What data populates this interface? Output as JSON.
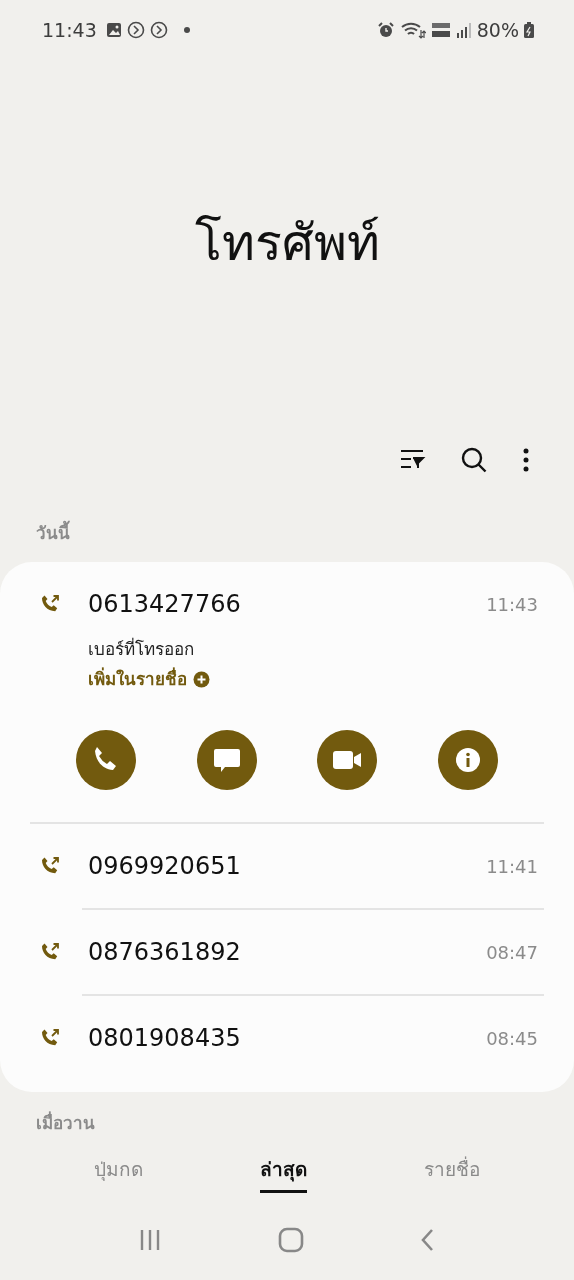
{
  "status_bar": {
    "time": "11:43",
    "battery": "80%"
  },
  "title": "โทรศัพท์",
  "sections": [
    {
      "header": "วันนี้",
      "calls": [
        {
          "number": "0613427766",
          "time": "11:43",
          "expanded": true,
          "detail": "เบอร์ที่โทรออก",
          "add_contact": "เพิ่มในรายชื่อ"
        },
        {
          "number": "0969920651",
          "time": "11:41",
          "expanded": false
        },
        {
          "number": "0876361892",
          "time": "08:47",
          "expanded": false
        },
        {
          "number": "0801908435",
          "time": "08:45",
          "expanded": false
        }
      ]
    },
    {
      "header": "เมื่อวาน"
    }
  ],
  "tabs": [
    {
      "label": "ปุ่มกด",
      "selected": false
    },
    {
      "label": "ล่าสุด",
      "selected": true
    },
    {
      "label": "รายชื่อ",
      "selected": false
    }
  ]
}
